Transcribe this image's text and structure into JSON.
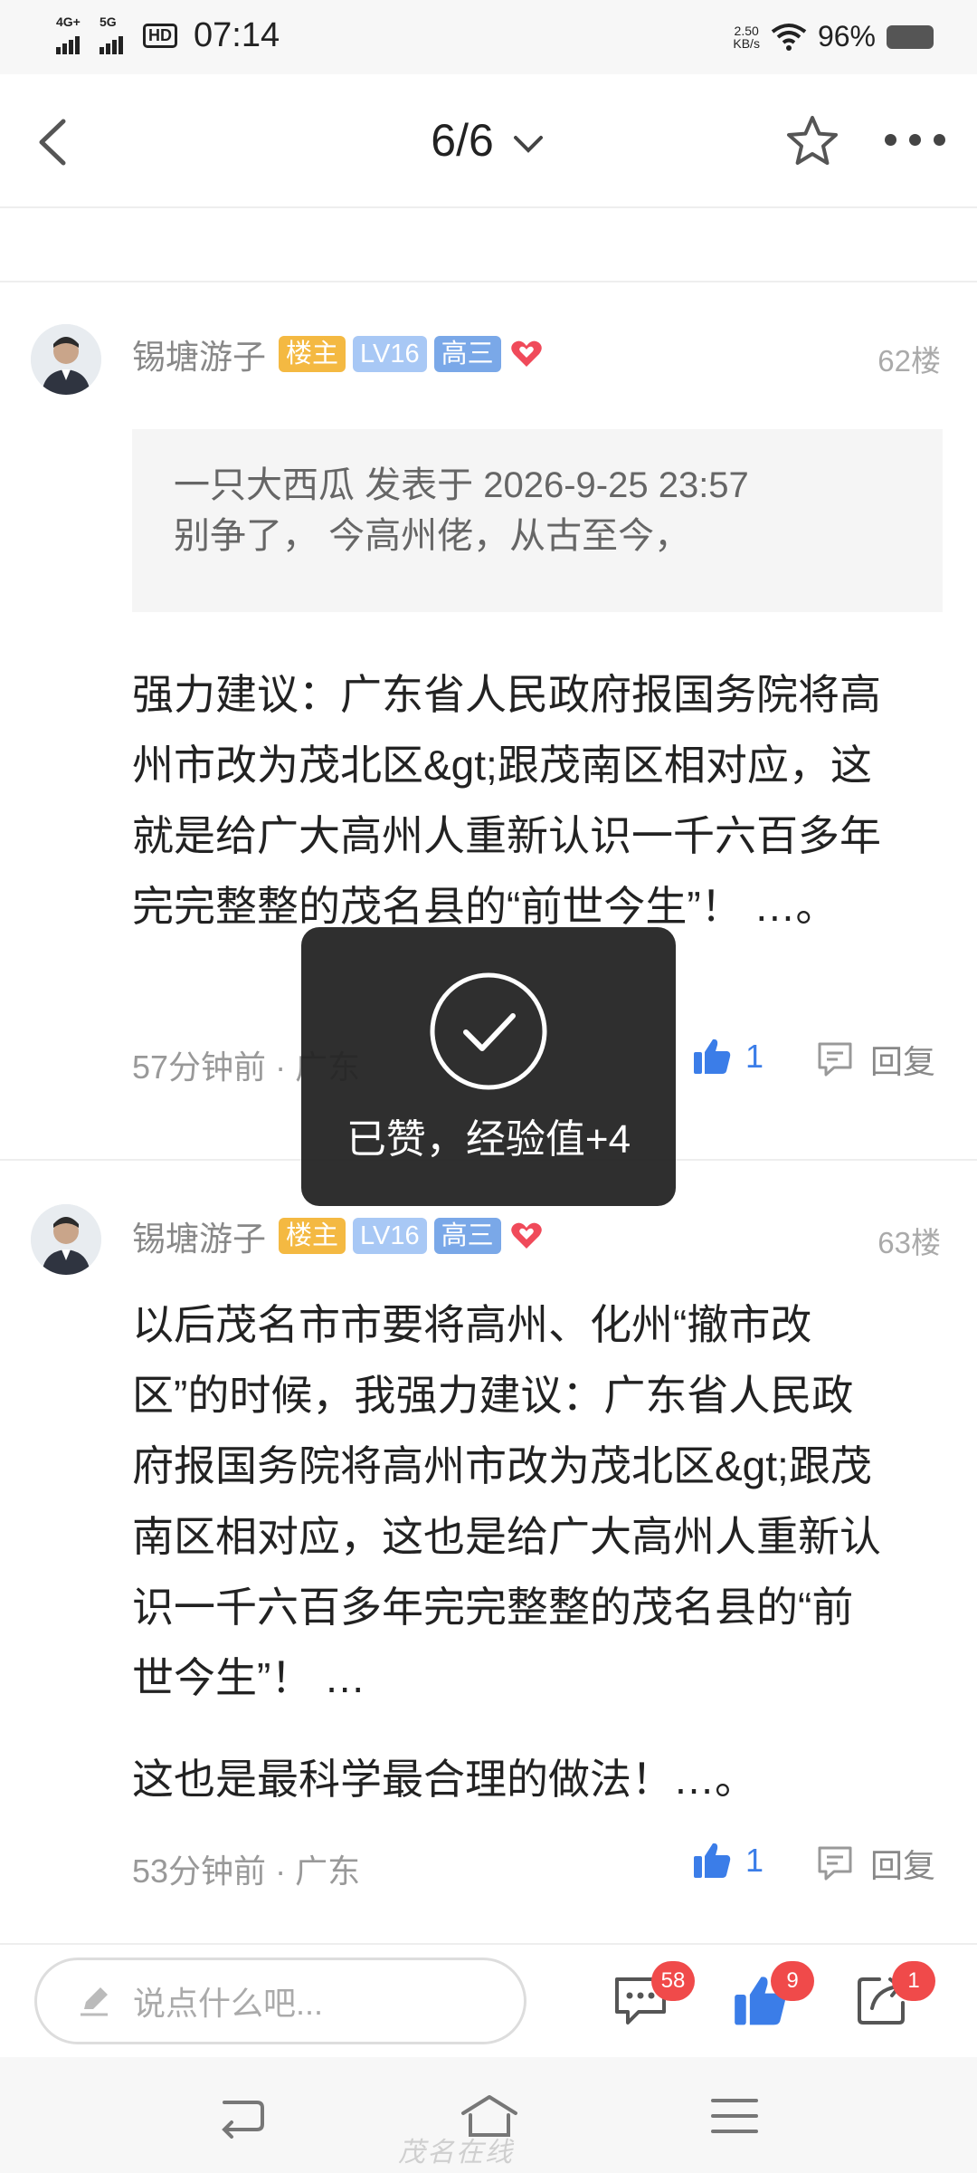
{
  "status_bar": {
    "signal1_label": "4G+",
    "signal2_label": "5G",
    "hd_label": "HD",
    "time": "07:14",
    "net_speed_value": "2.50",
    "net_speed_unit": "KB/s",
    "battery": "96%"
  },
  "nav": {
    "page_indicator": "6/6"
  },
  "posts": [
    {
      "author": "锡塘游子",
      "badges": [
        "楼主",
        "LV16",
        "高三"
      ],
      "floor": "62楼",
      "quote": {
        "header": "一只大西瓜 发表于 2026-9-25 23:57",
        "text": "别争了， 今高州佬，从古至今，"
      },
      "body": "强力建议：广东省人民政府报国务院将高州市改为茂北区&gt;跟茂南区相对应，这就是给广大高州人重新认识一千六百多年完完整整的茂名县的“前世今生”！ …。",
      "time": "57分钟前",
      "location": "广东",
      "likes": "1",
      "reply_label": "回复"
    },
    {
      "author": "锡塘游子",
      "badges": [
        "楼主",
        "LV16",
        "高三"
      ],
      "floor": "63楼",
      "body": "以后茂名市市要将高州、化州“撤市改区”的时候，我强力建议：广东省人民政府报国务院将高州市改为茂北区&gt;跟茂南区相对应，这也是给广大高州人重新认识一千六百多年完完整整的茂名县的“前世今生”！ …",
      "body2": "这也是最科学最合理的做法！…。",
      "time": "53分钟前",
      "location": "广东",
      "likes": "1",
      "reply_label": "回复"
    }
  ],
  "toast": {
    "message": "已赞，经验值+4"
  },
  "bottom_bar": {
    "input_placeholder": "说点什么吧...",
    "comments_count": "58",
    "likes_count": "9",
    "shares_count": "1"
  },
  "watermark": "茂名在线",
  "colors": {
    "accent_blue": "#3b7de8",
    "owner_badge": "#f4b942",
    "level_badge": "#a8c8f5",
    "grade_badge": "#7aa8e8",
    "heart": "#f04a5a",
    "count_badge": "#f04a4a"
  },
  "icons": [
    "back-icon",
    "chevron-down-icon",
    "star-icon",
    "more-icon",
    "heart-icon",
    "thumb-up-icon",
    "comment-icon",
    "edit-icon",
    "share-icon",
    "check-icon",
    "sys-back-icon",
    "sys-home-icon",
    "sys-menu-icon"
  ]
}
